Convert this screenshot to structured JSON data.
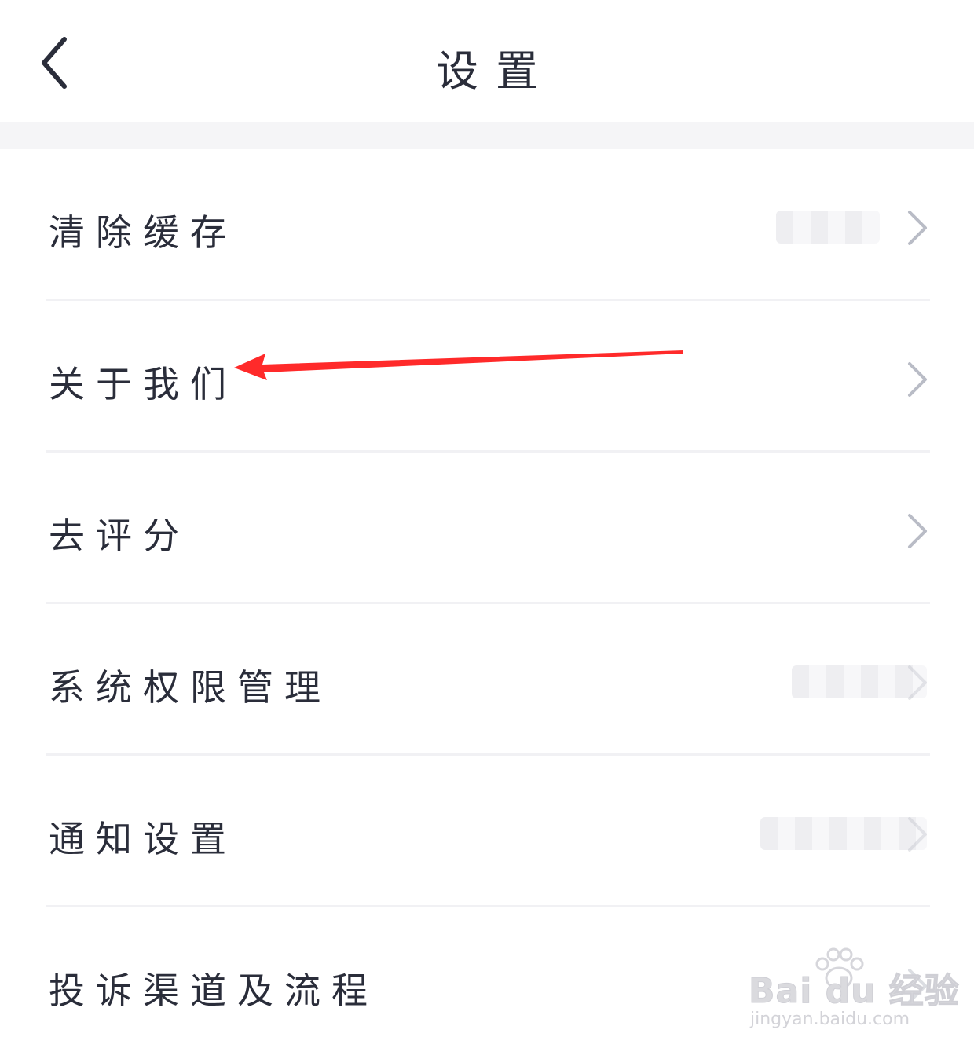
{
  "nav": {
    "title": "设置",
    "back_icon": "chevron-left-icon"
  },
  "settings": {
    "items": [
      {
        "label": "清除缓存",
        "value_blurred": true,
        "chevron_icon": "chevron-right-icon"
      },
      {
        "label": "关于我们",
        "value_blurred": false,
        "chevron_icon": "chevron-right-icon"
      },
      {
        "label": "去评分",
        "value_blurred": false,
        "chevron_icon": "chevron-right-icon"
      },
      {
        "label": "系统权限管理",
        "value_blurred": true,
        "chevron_icon": "chevron-right-icon"
      },
      {
        "label": "通知设置",
        "value_blurred": true,
        "chevron_icon": "chevron-right-icon"
      },
      {
        "label": "投诉渠道及流程",
        "value_blurred": false,
        "chevron_icon": "chevron-right-icon"
      }
    ]
  },
  "annotation": {
    "arrow_color": "#ff2a2a",
    "points_to": "关于我们"
  },
  "watermark": {
    "brand": "Bai du 经验",
    "url": "jingyan.baidu.com"
  },
  "colors": {
    "text": "#2a2d3a",
    "chevron": "#b9bcc6",
    "divider": "#f1f1f4",
    "band": "#f5f5f7"
  }
}
